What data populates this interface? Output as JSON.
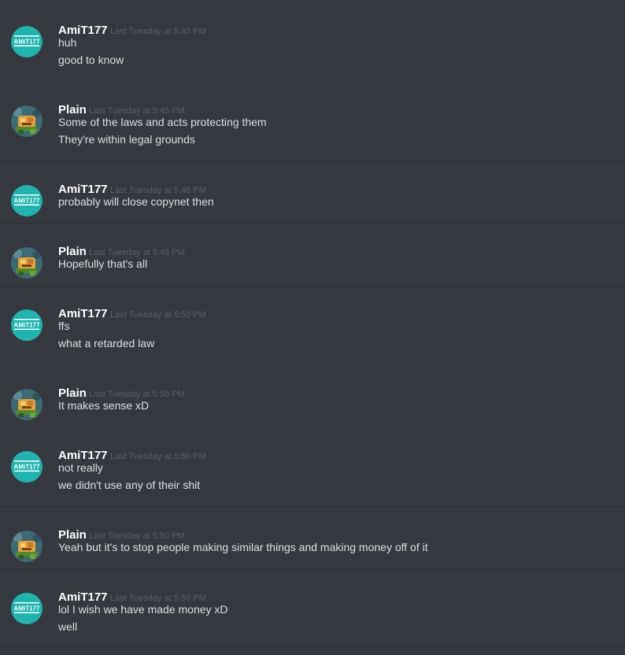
{
  "messages": [
    {
      "author": "AmiT177",
      "avatar": "amit-logo-icon",
      "timestamp": "Last Tuesday at 5:45 PM",
      "lines": [
        "huh",
        "good to know"
      ]
    },
    {
      "author": "Plain",
      "avatar": "cartoon-avatar-icon",
      "timestamp": "Last Tuesday at 5:45 PM",
      "lines": [
        "Some of the laws and acts protecting them",
        "They're within legal grounds"
      ]
    },
    {
      "author": "AmiT177",
      "avatar": "amit-logo-icon",
      "timestamp": "Last Tuesday at 5:46 PM",
      "lines": [
        "probably will close copynet then"
      ]
    },
    {
      "author": "Plain",
      "avatar": "cartoon-avatar-icon",
      "timestamp": "Last Tuesday at 5:46 PM",
      "lines": [
        "Hopefully that's all"
      ]
    },
    {
      "author": "AmiT177",
      "avatar": "amit-logo-icon",
      "timestamp": "Last Tuesday at 5:50 PM",
      "lines": [
        "ffs",
        "what a retarded law"
      ]
    },
    {
      "author": "Plain",
      "avatar": "cartoon-avatar-icon",
      "timestamp": "Last Tuesday at 5:50 PM",
      "lines": [
        "It makes sense xD"
      ]
    },
    {
      "author": "AmiT177",
      "avatar": "amit-logo-icon",
      "timestamp": "Last Tuesday at 5:50 PM",
      "lines": [
        "not really",
        "we didn't use any of their shit"
      ]
    },
    {
      "author": "Plain",
      "avatar": "cartoon-avatar-icon",
      "timestamp": "Last Tuesday at 5:50 PM",
      "lines": [
        "Yeah but it's to stop people making similar things and making money off of it"
      ]
    },
    {
      "author": "AmiT177",
      "avatar": "amit-logo-icon",
      "timestamp": "Last Tuesday at 5:50 PM",
      "lines": [
        "lol I wish we have made money xD",
        "well"
      ]
    }
  ],
  "avatars": {
    "AmiT177": {
      "logo_text": "AMiT177",
      "color": "#1fb4ae"
    },
    "Plain": {
      "color": "#e2a33a"
    }
  },
  "colors": {
    "background": "#36393f",
    "divider": "#2e3035",
    "username": "#ffffff",
    "timestamp": "#5d6168",
    "message_text": "#dcddde"
  }
}
